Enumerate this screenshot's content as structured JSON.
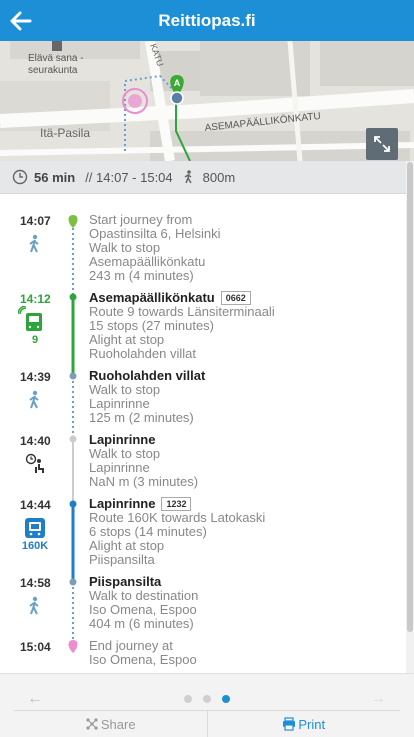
{
  "header": {
    "title": "Reittiopas.fi"
  },
  "map": {
    "labels": {
      "poi": "Elävä sana -\nseurakunta",
      "poi_line1": "Elävä sana -",
      "poi_line2": "seurakunta",
      "district": "Itä-Pasila",
      "street": "ASEMAPÄÄLLIKÖNKATU",
      "street2": "KATU"
    },
    "marker_label": "A"
  },
  "summary": {
    "duration": "56 min",
    "range": "// 14:07 - 15:04",
    "walk": "800m"
  },
  "legs": [
    {
      "time": "14:07",
      "line1": "Start journey from",
      "line2": "Opastinsilta 6, Helsinki",
      "line3": "Walk to stop",
      "line4": "Asemapäällikönkatu",
      "line5": "243 m (4 minutes)"
    },
    {
      "time": "14:12",
      "mode_num": "9",
      "place": "Asemapäällikönkatu",
      "code": "0662",
      "line2": "Route 9 towards Länsiterminaali",
      "line3": "15 stops (27 minutes)",
      "line4": "Alight at stop",
      "line5": "Ruoholahden villat"
    },
    {
      "time": "14:39",
      "place": "Ruoholahden villat",
      "line2": "Walk to stop",
      "line3": "Lapinrinne",
      "line4": "125 m (2 minutes)"
    },
    {
      "time": "14:40",
      "place": "Lapinrinne",
      "line2": "Walk to stop",
      "line3": "Lapinrinne",
      "line4": "NaN m (3 minutes)"
    },
    {
      "time": "14:44",
      "mode_num": "160K",
      "place": "Lapinrinne",
      "code": "1232",
      "line2": "Route 160K towards Latokaski",
      "line3": "6 stops (14 minutes)",
      "line4": "Alight at stop",
      "line5": "Piispansilta"
    },
    {
      "time": "14:58",
      "place": "Piispansilta",
      "line2": "Walk to destination",
      "line3": "Iso Omena, Espoo",
      "line4": "404 m (6 minutes)"
    },
    {
      "time": "15:04",
      "line1": "End journey at",
      "line2": "Iso Omena, Espoo"
    }
  ],
  "footer": {
    "prev": "←",
    "next": "→",
    "share": "Share",
    "print": "Print"
  },
  "colors": {
    "brand": "#1d8fd6",
    "tram": "#2da43c",
    "bus": "#1f7ec8",
    "walk": "#6aa0c7",
    "end": "#ec8dcf"
  }
}
